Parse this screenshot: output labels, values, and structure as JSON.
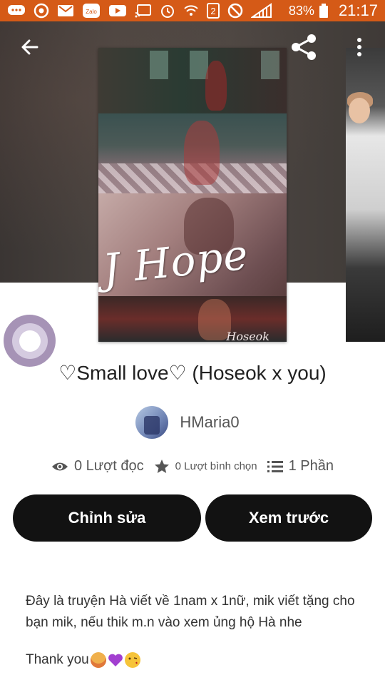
{
  "status_bar": {
    "battery_percent": "83%",
    "time": "21:17",
    "sim_slot": "2",
    "app_badge": "Zalo"
  },
  "header": {
    "back_icon": "arrow-left-icon",
    "share_icon": "share-icon",
    "menu_icon": "more-vertical-icon"
  },
  "cover": {
    "title_text": "J Hope",
    "signature": "Hoseok"
  },
  "story": {
    "title": "♡Small love♡ (Hoseok x you)",
    "author": "HMaria0"
  },
  "stats": {
    "reads": "0 Lượt đọc",
    "votes": "0 Lượt bình chọn",
    "parts": "1 Phần"
  },
  "actions": {
    "edit": "Chỉnh sửa",
    "preview": "Xem trước"
  },
  "description": {
    "text": "Đây là truyện Hà viết về 1nam x 1nữ, mik viết tặng cho bạn mik, nếu thik m.n vào xem ủng hộ Hà nhe",
    "thanks": "Thank you"
  },
  "colors": {
    "status_bar": "#d55a17",
    "button_bg": "#121212",
    "fab": "#a693b6"
  }
}
